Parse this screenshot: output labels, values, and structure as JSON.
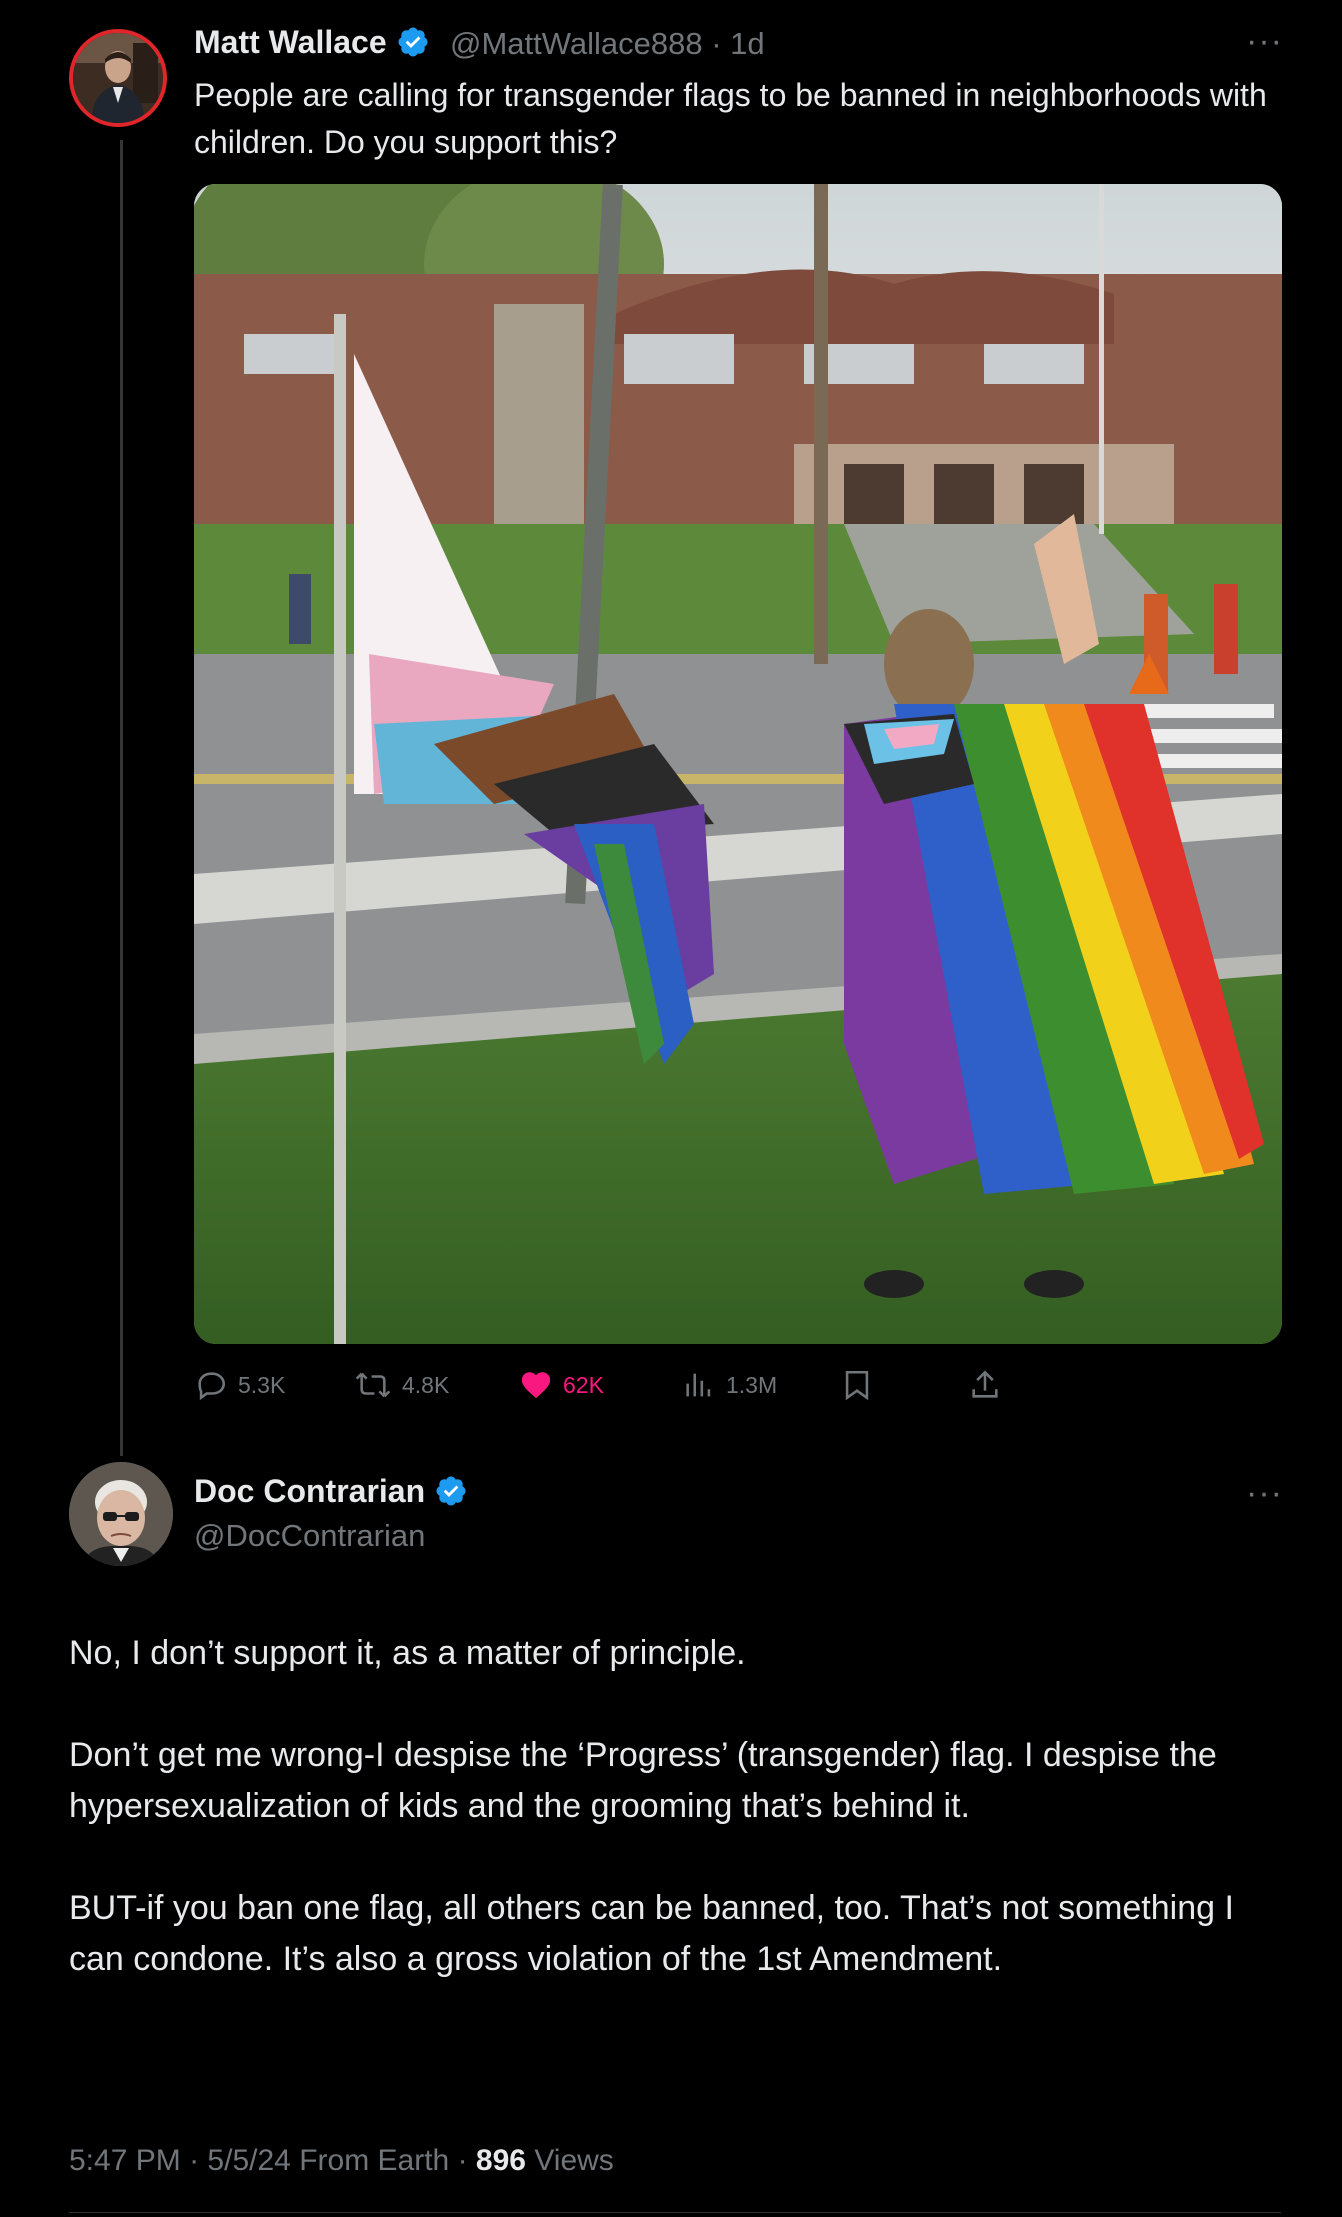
{
  "parent": {
    "author_name": "Matt Wallace",
    "handle": "@MattWallace888",
    "separator": "·",
    "age": "1d",
    "text": "People are calling for transgender flags to be banned in neighborhoods with children. Do you support this?",
    "verified": true,
    "stats": {
      "replies": "5.3K",
      "reposts": "4.8K",
      "likes": "62K",
      "views": "1.3M"
    }
  },
  "reply": {
    "author_name": "Doc Contrarian",
    "handle": "@DocContrarian",
    "verified": true,
    "paragraphs": [
      "No, I don’t support it, as a matter of principle.",
      "Don’t get me wrong-I despise the ‘Progress’ (transgender) flag. I despise the hypersexualization of kids and the grooming that’s behind it.",
      "BUT-if you ban one flag, all others can be banned, too. That’s not something I can condone. It’s also a gross violation of the 1st Amendment."
    ],
    "time": "5:47 PM",
    "date": "5/5/24",
    "source": "From Earth",
    "dot": "·",
    "view_count": "896",
    "views_label": "Views"
  },
  "colors": {
    "background": "#000000",
    "text": "#e7e9ea",
    "secondary": "#71767b",
    "verified": "#1d9bf0",
    "like": "#f91880",
    "avatar_ring": "#e0262a"
  },
  "icons": [
    "reply-icon",
    "repost-icon",
    "heart-icon",
    "views-icon",
    "bookmark-icon",
    "share-icon",
    "verified-icon",
    "more-icon"
  ]
}
